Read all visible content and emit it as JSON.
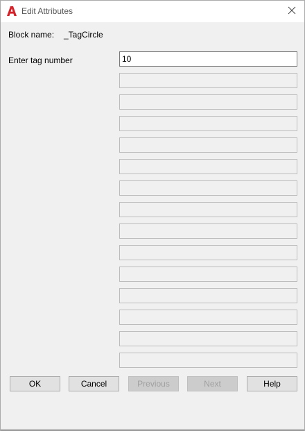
{
  "window": {
    "title": "Edit Attributes",
    "close_glyph": "✕"
  },
  "block": {
    "label": "Block name:",
    "value": "_TagCircle"
  },
  "attributes": {
    "prompt": "Enter tag number",
    "value": "10",
    "empty_field_count": 14
  },
  "buttons": {
    "ok": "OK",
    "cancel": "Cancel",
    "previous": "Previous",
    "next": "Next",
    "help": "Help"
  },
  "colors": {
    "brand_red": "#d2232a",
    "dialog_bg": "#f0f0f0"
  },
  "icons": {
    "app": "autocad-a-icon",
    "close": "close-icon"
  }
}
